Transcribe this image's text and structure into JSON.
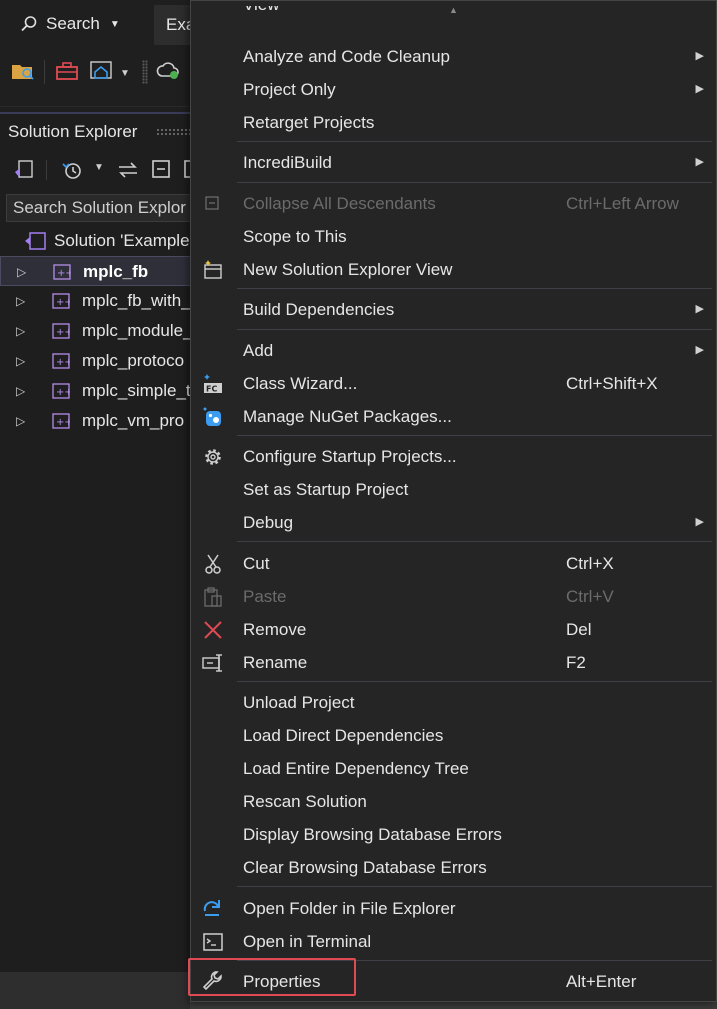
{
  "topbar": {
    "search_label": "Search",
    "tab_label": "Exa"
  },
  "solution_explorer": {
    "title": "Solution Explorer",
    "search_placeholder": "Search Solution Explor",
    "solution_label": "Solution 'Example",
    "projects": [
      {
        "label": "mplc_fb"
      },
      {
        "label": "mplc_fb_with_"
      },
      {
        "label": "mplc_module_"
      },
      {
        "label": "mplc_protoco"
      },
      {
        "label": "mplc_simple_t"
      },
      {
        "label": "mplc_vm_pro"
      }
    ]
  },
  "menu": {
    "partial_top": "View",
    "items": [
      {
        "label": "Analyze and Code Cleanup"
      },
      {
        "label": "Project Only"
      },
      {
        "label": "Retarget Projects"
      },
      {
        "label": "IncrediBuild"
      },
      {
        "label": "Collapse All Descendants",
        "shortcut": "Ctrl+Left Arrow"
      },
      {
        "label": "Scope to This"
      },
      {
        "label": "New Solution Explorer View"
      },
      {
        "label": "Build Dependencies"
      },
      {
        "label": "Add"
      },
      {
        "label": "Class Wizard...",
        "shortcut": "Ctrl+Shift+X"
      },
      {
        "label": "Manage NuGet Packages..."
      },
      {
        "label": "Configure Startup Projects..."
      },
      {
        "label": "Set as Startup Project"
      },
      {
        "label": "Debug"
      },
      {
        "label": "Cut",
        "shortcut": "Ctrl+X"
      },
      {
        "label": "Paste",
        "shortcut": "Ctrl+V"
      },
      {
        "label": "Remove",
        "shortcut": "Del"
      },
      {
        "label": "Rename",
        "shortcut": "F2"
      },
      {
        "label": "Unload Project"
      },
      {
        "label": "Load Direct Dependencies"
      },
      {
        "label": "Load Entire Dependency Tree"
      },
      {
        "label": "Rescan Solution"
      },
      {
        "label": "Display Browsing Database Errors"
      },
      {
        "label": "Clear Browsing Database Errors"
      },
      {
        "label": "Open Folder in File Explorer"
      },
      {
        "label": "Open in Terminal"
      },
      {
        "label": "Properties",
        "shortcut": "Alt+Enter"
      }
    ]
  },
  "colors": {
    "highlight_border": "#e04a52",
    "menu_bg": "#252526",
    "remove_icon": "#e04a52",
    "accent_blue": "#3c9cf0"
  }
}
